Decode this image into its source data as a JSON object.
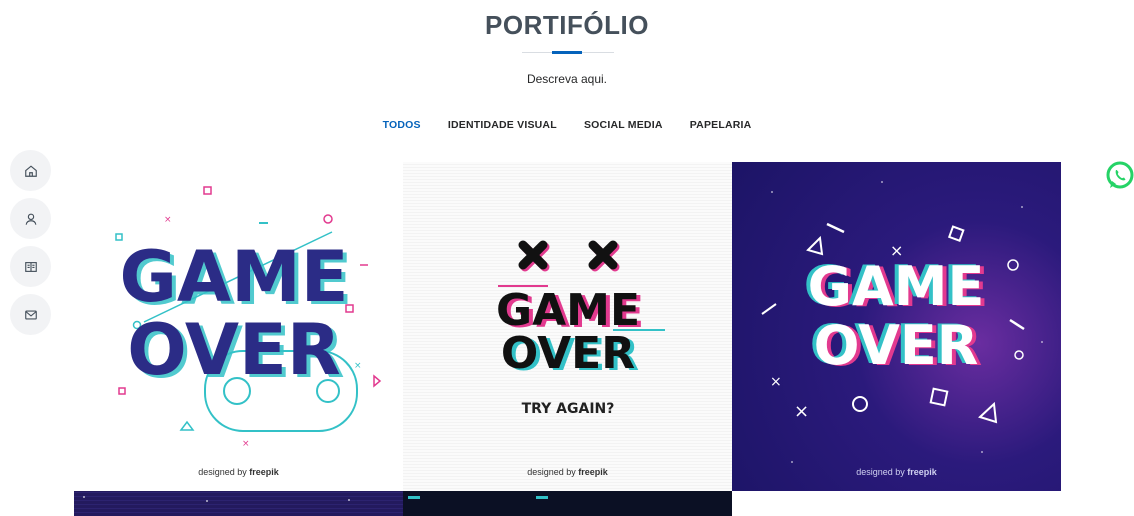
{
  "portfolio": {
    "title": "PORTIFÓLIO",
    "subtitle": "Descreva aqui."
  },
  "filters": [
    {
      "label": "TODOS",
      "active": true
    },
    {
      "label": "IDENTIDADE VISUAL",
      "active": false
    },
    {
      "label": "SOCIAL MEDIA",
      "active": false
    },
    {
      "label": "PAPELARIA",
      "active": false
    }
  ],
  "side_nav": [
    "home-icon",
    "user-icon",
    "book-icon",
    "mail-icon"
  ],
  "gallery": [
    {
      "line1": "GAME",
      "line2": "OVER",
      "credit_prefix": "designed by",
      "credit_brand": "freepik"
    },
    {
      "line1": "GAME",
      "line2": "OVER",
      "tagline": "TRY AGAIN?",
      "credit_prefix": "designed by",
      "credit_brand": "freepik"
    },
    {
      "line1": "GAME",
      "line2": "OVER",
      "credit_prefix": "designed by",
      "credit_brand": "freepik"
    }
  ],
  "colors": {
    "accent": "#0563bb",
    "heading": "#45505b",
    "whatsapp": "#25d366"
  }
}
